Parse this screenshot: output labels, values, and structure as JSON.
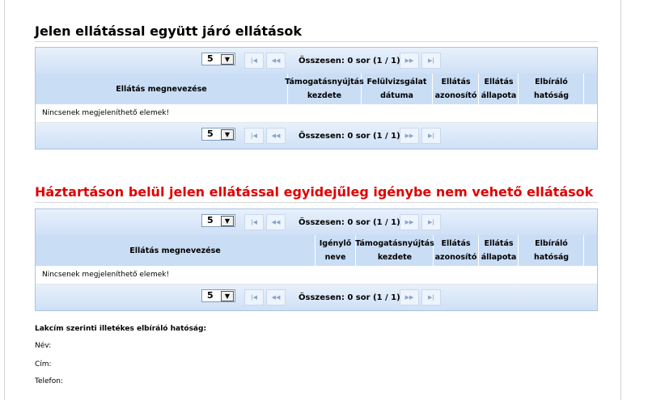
{
  "section1": {
    "title": "Jelen ellátással együtt járó ellátások",
    "pager_top": {
      "page_size": "5",
      "summary": "Összesen: 0 sor (1 / 1)"
    },
    "columns": [
      "Ellátás megnevezése",
      "Támogatásnyújtás kezdete",
      "Felülvizsgálat dátuma",
      "Ellátás azonosító",
      "Ellátás állapota",
      "Elbíráló hatóság"
    ],
    "empty_message": "Nincsenek megjeleníthető elemek!",
    "pager_bottom": {
      "page_size": "5",
      "summary": "Összesen: 0 sor (1 / 1)"
    }
  },
  "section2": {
    "title": "Háztartáson belül jelen ellátással egyidejűleg igénybe nem vehető ellátások",
    "title_color": "#e00000",
    "pager_top": {
      "page_size": "5",
      "summary": "Összesen: 0 sor (1 / 1)"
    },
    "columns": [
      "Ellátás megnevezése",
      "Igénylő neve",
      "Támogatásnyújtás kezdete",
      "Ellátás azonosító",
      "Ellátás állapota",
      "Elbíráló hatóság"
    ],
    "empty_message": "Nincsenek megjeleníthető elemek!",
    "pager_bottom": {
      "page_size": "5",
      "summary": "Összesen: 0 sor (1 / 1)"
    }
  },
  "authority": {
    "heading": "Lakcím szerinti illetékes elbíráló hatóság:",
    "name_label": "Név:",
    "address_label": "Cím:",
    "phone_label": "Telefon:"
  },
  "icons": {
    "first": "first-page-icon",
    "prev": "prev-page-icon",
    "next": "next-page-icon",
    "last": "last-page-icon",
    "dropdown": "dropdown-arrow-icon"
  },
  "colors": {
    "grid_header": "#c9ddf5",
    "grid_border": "#aac4e4",
    "red_title": "#e00000"
  }
}
